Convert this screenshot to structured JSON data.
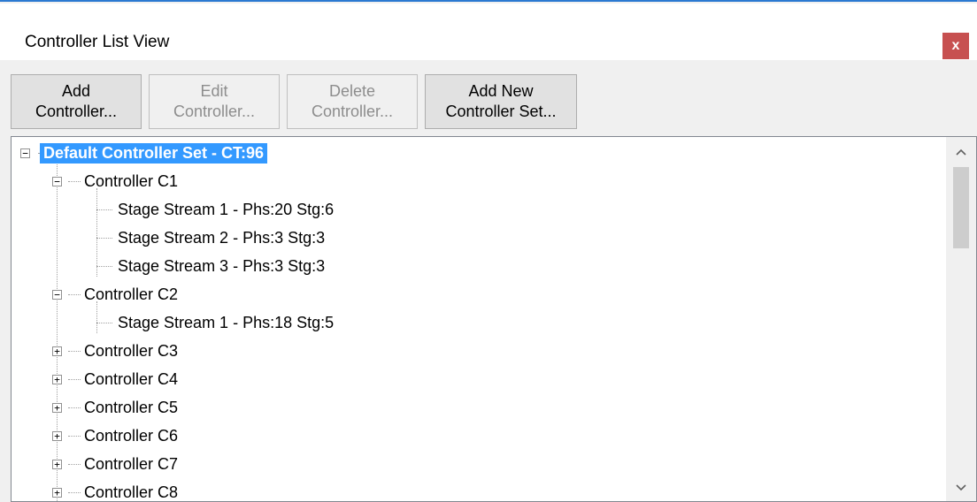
{
  "window": {
    "title": "Controller List View",
    "close_label": "x",
    "accent_color": "#2b79d1",
    "close_color": "#c75050"
  },
  "toolbar": {
    "add_controller": {
      "line1": "Add",
      "line2": "Controller...",
      "enabled": true
    },
    "edit_controller": {
      "line1": "Edit",
      "line2": "Controller...",
      "enabled": false
    },
    "delete_controller": {
      "line1": "Delete",
      "line2": "Controller...",
      "enabled": false
    },
    "add_controller_set": {
      "line1": "Add New",
      "line2": "Controller Set...",
      "enabled": true
    }
  },
  "tree": {
    "root": {
      "label": "Default Controller Set - CT:96",
      "expanded": true,
      "selected": true
    },
    "nodes": [
      {
        "label": "Controller C1",
        "expanded": true,
        "children": [
          "Stage Stream 1 - Phs:20 Stg:6",
          "Stage Stream 2 - Phs:3 Stg:3",
          "Stage Stream 3 - Phs:3 Stg:3"
        ]
      },
      {
        "label": "Controller C2",
        "expanded": true,
        "children": [
          "Stage Stream 1 - Phs:18 Stg:5"
        ]
      },
      {
        "label": "Controller C3",
        "expanded": false
      },
      {
        "label": "Controller C4",
        "expanded": false
      },
      {
        "label": "Controller C5",
        "expanded": false
      },
      {
        "label": "Controller C6",
        "expanded": false
      },
      {
        "label": "Controller C7",
        "expanded": false
      },
      {
        "label": "Controller C8",
        "expanded": false
      }
    ],
    "selection_color": "#3399ff",
    "expand_glyph": "+",
    "collapse_glyph": "−"
  },
  "scrollbar": {
    "up_icon": "^",
    "down_icon": "v"
  }
}
